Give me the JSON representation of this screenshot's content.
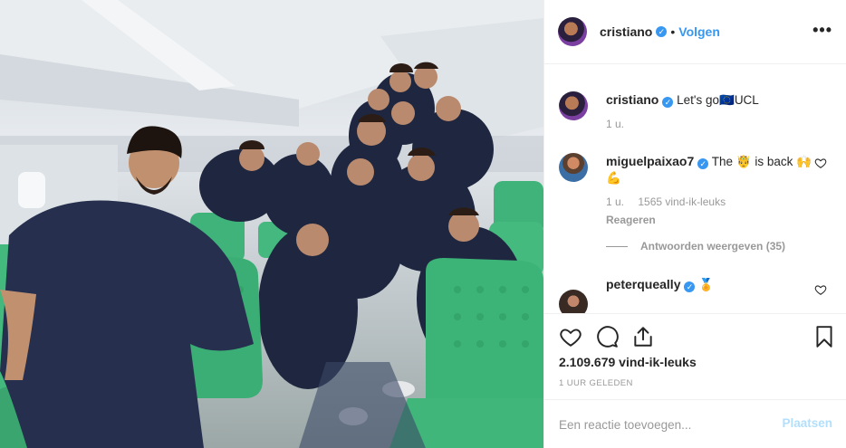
{
  "photo": {
    "alt": ""
  },
  "header": {
    "username": "cristiano",
    "separator": "•",
    "follow_label": "Volgen",
    "more_label": "•••"
  },
  "caption": {
    "username": "cristiano",
    "text_before": "Let's go",
    "emoji": "🇪🇺",
    "text_after": "UCL",
    "time": "1 u."
  },
  "comments": [
    {
      "username": "miguelpaixao7",
      "text": "The 🤴 is back 🙌💪",
      "time": "1 u.",
      "likes": "1565 vind-ik-leuks",
      "reply_label": "Reageren"
    },
    {
      "username": "peterqueally",
      "text": "🏅"
    }
  ],
  "view_replies_label": "Antwoorden weergeven (35)",
  "actions": {
    "likes": "2.109.679 vind-ik-leuks",
    "time_ago": "1 UUR GELEDEN"
  },
  "add_comment": {
    "placeholder": "Een reactie toevoegen...",
    "post_label": "Plaatsen"
  },
  "colors": {
    "accent": "#3897f0",
    "post_disabled": "#b2dffc",
    "seat_green": "#3fb37a",
    "text": "#262626",
    "muted": "#999999"
  }
}
